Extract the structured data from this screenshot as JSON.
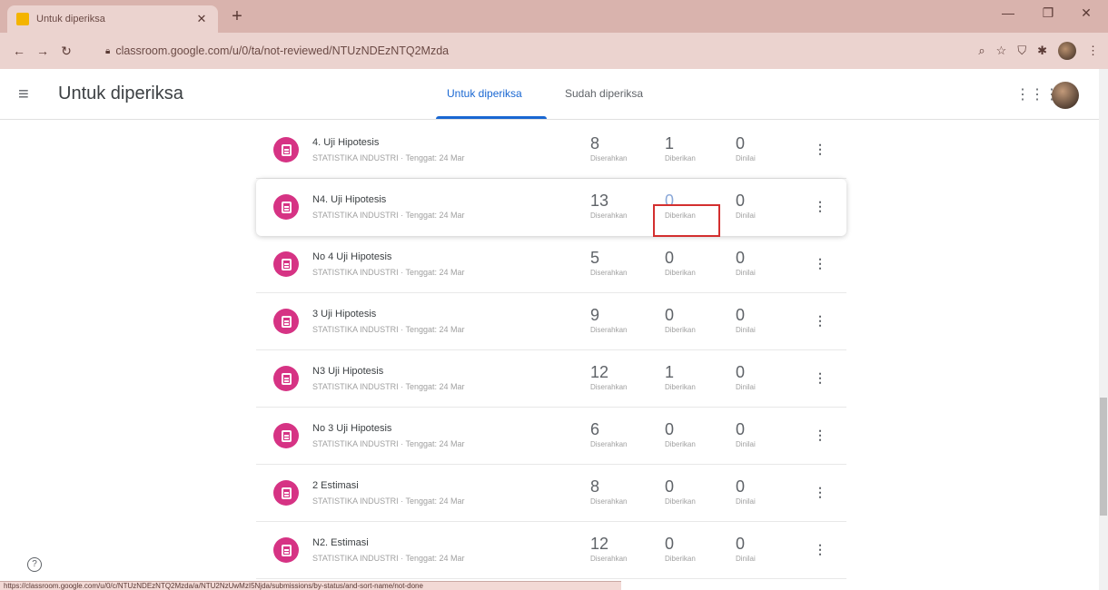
{
  "browser": {
    "tab_title": "Untuk diperiksa",
    "new_tab": "+",
    "url": "classroom.google.com/u/0/ta/not-reviewed/NTUzNDEzNTQ2Mzda",
    "status_url": "https://classroom.google.com/u/0/c/NTUzNDEzNTQ2Mzda/a/NTU2NzUwMzI5Njda/submissions/by-status/and-sort-name/not-done"
  },
  "app": {
    "title": "Untuk diperiksa",
    "tabs": [
      {
        "label": "Untuk diperiksa"
      },
      {
        "label": "Sudah diperiksa"
      }
    ]
  },
  "labels": {
    "submitted": "Diserahkan",
    "assigned": "Diberikan",
    "graded": "Dinilai"
  },
  "rows": [
    {
      "title": "4. Uji Hipotesis",
      "subtitle": "STATISTIKA INDUSTRI · Tenggat: 24 Mar",
      "submitted": "8",
      "assigned": "1",
      "graded": "0"
    },
    {
      "title": "N4. Uji Hipotesis",
      "subtitle": "STATISTIKA INDUSTRI · Tenggat: 24 Mar",
      "submitted": "13",
      "assigned": "0",
      "graded": "0"
    },
    {
      "title": "No 4 Uji Hipotesis",
      "subtitle": "STATISTIKA INDUSTRI · Tenggat: 24 Mar",
      "submitted": "5",
      "assigned": "0",
      "graded": "0"
    },
    {
      "title": "3 Uji Hipotesis",
      "subtitle": "STATISTIKA INDUSTRI · Tenggat: 24 Mar",
      "submitted": "9",
      "assigned": "0",
      "graded": "0"
    },
    {
      "title": "N3 Uji Hipotesis",
      "subtitle": "STATISTIKA INDUSTRI · Tenggat: 24 Mar",
      "submitted": "12",
      "assigned": "1",
      "graded": "0"
    },
    {
      "title": "No 3 Uji Hipotesis",
      "subtitle": "STATISTIKA INDUSTRI · Tenggat: 24 Mar",
      "submitted": "6",
      "assigned": "0",
      "graded": "0"
    },
    {
      "title": "2 Estimasi",
      "subtitle": "STATISTIKA INDUSTRI · Tenggat: 24 Mar",
      "submitted": "8",
      "assigned": "0",
      "graded": "0"
    },
    {
      "title": "N2. Estimasi",
      "subtitle": "STATISTIKA INDUSTRI · Tenggat: 24 Mar",
      "submitted": "12",
      "assigned": "0",
      "graded": "0"
    }
  ]
}
